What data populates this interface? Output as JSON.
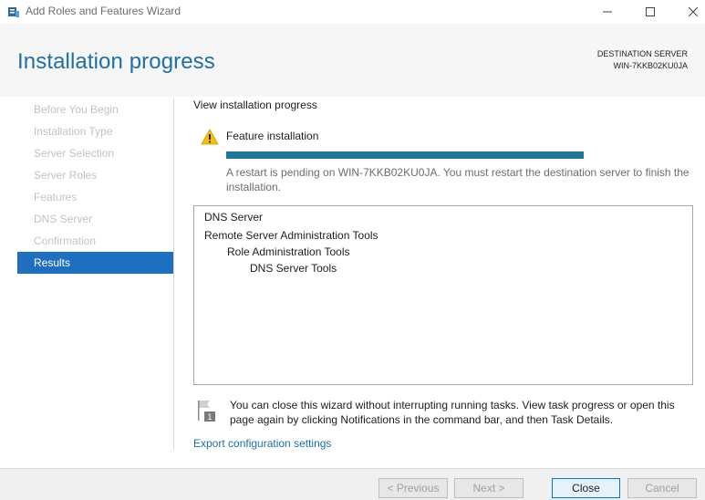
{
  "window": {
    "title": "Add Roles and Features Wizard"
  },
  "header": {
    "page_title": "Installation progress",
    "destination_label": "DESTINATION SERVER",
    "destination_server": "WIN-7KKB02KU0JA"
  },
  "nav": {
    "items": [
      {
        "label": "Before You Begin",
        "active": false
      },
      {
        "label": "Installation Type",
        "active": false
      },
      {
        "label": "Server Selection",
        "active": false
      },
      {
        "label": "Server Roles",
        "active": false
      },
      {
        "label": "Features",
        "active": false
      },
      {
        "label": "DNS Server",
        "active": false
      },
      {
        "label": "Confirmation",
        "active": false
      },
      {
        "label": "Results",
        "active": true
      }
    ]
  },
  "main": {
    "section_title": "View installation progress",
    "feature_label": "Feature installation",
    "progress_fraction": 1.0,
    "restart_message": "A restart is pending on WIN-7KKB02KU0JA. You must restart the destination server to finish the installation.",
    "results": [
      {
        "label": "DNS Server",
        "level": 0
      },
      {
        "label": "Remote Server Administration Tools",
        "level": 0
      },
      {
        "label": "Role Administration Tools",
        "level": 1
      },
      {
        "label": "DNS Server Tools",
        "level": 2
      }
    ],
    "info_text": "You can close this wizard without interrupting running tasks. View task progress or open this page again by clicking Notifications in the command bar, and then Task Details.",
    "info_badge": "1",
    "export_link": "Export configuration settings"
  },
  "footer": {
    "previous_label": "< Previous",
    "next_label": "Next >",
    "close_label": "Close",
    "cancel_label": "Cancel"
  },
  "colors": {
    "accent": "#1e6fc0",
    "title_blue": "#1d6fa8",
    "progress": "#1e7597",
    "warning": "#f5c400"
  },
  "icons": {
    "app": "server-manager-icon",
    "warning": "warning-icon",
    "info": "notification-flag-icon"
  }
}
